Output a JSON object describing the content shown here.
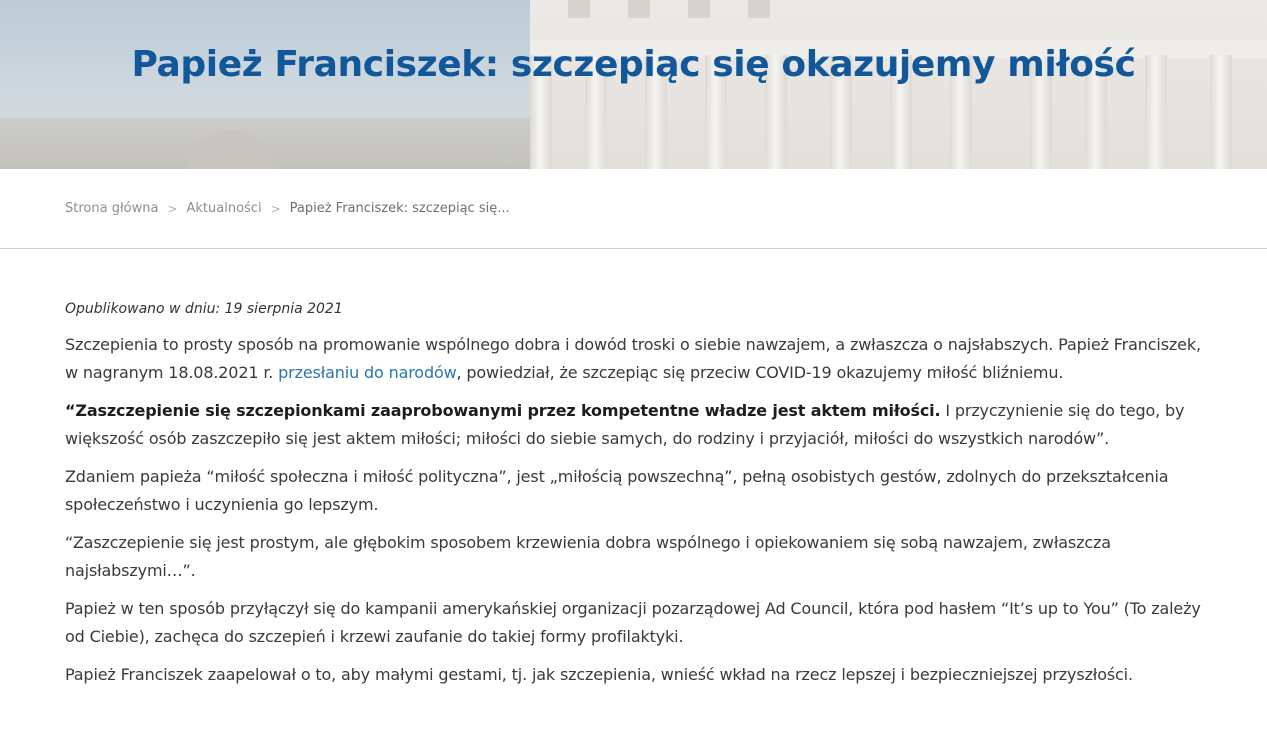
{
  "hero": {
    "title": "Papież Franciszek: szczepiąc się okazujemy miłość"
  },
  "breadcrumb": {
    "home": "Strona główna",
    "section": "Aktualności",
    "current": "Papież Franciszek: szczepiąc się...",
    "separator": ">"
  },
  "article": {
    "published": "Opublikowano w dniu: 19 sierpnia 2021",
    "p1_before": "Szczepienia to prosty sposób na promowanie wspólnego dobra i dowód troski o siebie nawzajem, a zwłaszcza o najsłabszych. Papież Franciszek, w nagranym 18.08.2021 r. ",
    "p1_link": "przesłaniu do narodów",
    "p1_after": ", powiedział, że szczepiąc się przeciw COVID-19 okazujemy miłość bliźniemu.",
    "p2_bold": "“Zaszczepienie się szczepionkami zaaprobowanymi przez kompetentne władze jest aktem miłości.",
    "p2_rest": " I przyczynienie się do tego, by większość osób zaszczepiło się jest aktem miłości; miłości do siebie samych, do rodziny i przyjaciół, miłości do wszystkich narodów”.",
    "p3": "Zdaniem papieża “miłość społeczna i miłość polityczna”, jest „miłością powszechną”, pełną osobistych gestów, zdolnych do przekształcenia społeczeństwo i uczynienia go lepszym.",
    "p4": "“Zaszczepienie się jest prostym, ale głębokim sposobem krzewienia dobra wspólnego i opiekowaniem się sobą nawzajem, zwłaszcza najsłabszymi…”.",
    "p5": "Papież w ten sposób przyłączył się do kampanii amerykańskiej organizacji pozarządowej Ad Council, która pod hasłem “It’s up to You” (To zależy od Ciebie), zachęca do szczepień i krzewi zaufanie do takiej formy profilaktyki.",
    "p6": "Papież Franciszek zaapelował o to, aby małymi gestami, tj. jak szczepienia, wnieść wkład na rzecz lepszej i bezpieczniejszej przyszłości."
  },
  "colors": {
    "title": "#12579a",
    "link": "#2a76ad",
    "text": "#3a3a3a"
  }
}
